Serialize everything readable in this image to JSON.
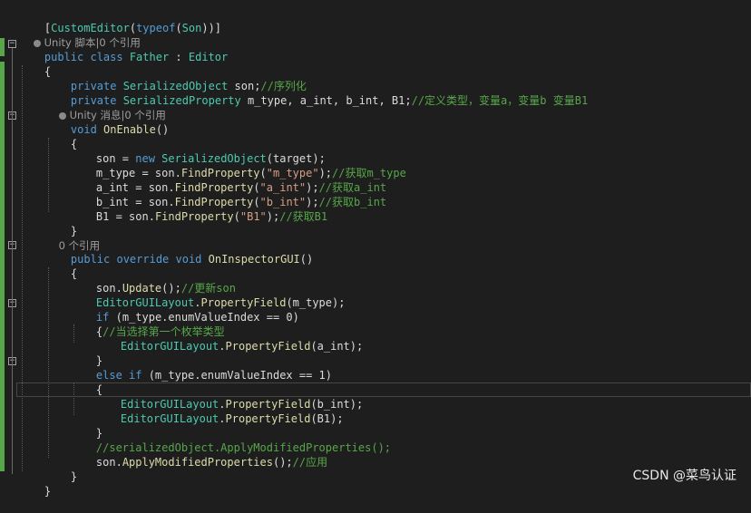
{
  "lines": {
    "l1": {
      "a": "[",
      "b": "CustomEditor",
      "c": "(",
      "d": "typeof",
      "e": "(",
      "f": "Son",
      "g": "))]"
    },
    "lens1": "Unity 脚本|0 个引用",
    "l3": {
      "a": "public class ",
      "b": "Father",
      "c": " : ",
      "d": "Editor"
    },
    "l4": "{",
    "l5": {
      "a": "private ",
      "b": "SerializedObject",
      "c": " son;",
      "d": "//序列化"
    },
    "l6": {
      "a": "private ",
      "b": "SerializedProperty",
      "c": " m_type, a_int, b_int, B1;",
      "d": "//定义类型，变量a，变量b 变量B1"
    },
    "lens2": "Unity 消息|0 个引用",
    "l8": {
      "a": "void ",
      "b": "OnEnable",
      "c": "()"
    },
    "l9": "{",
    "l10": {
      "a": "son = ",
      "b": "new ",
      "c": "SerializedObject",
      "d": "(target);"
    },
    "l11": {
      "a": "m_type = son.",
      "b": "FindProperty",
      "c": "(",
      "d": "\"m_type\"",
      "e": ");",
      "f": "//获取m_type"
    },
    "l12": {
      "a": "a_int = son.",
      "b": "FindProperty",
      "c": "(",
      "d": "\"a_int\"",
      "e": ");",
      "f": "//获取a_int"
    },
    "l13": {
      "a": "b_int = son.",
      "b": "FindProperty",
      "c": "(",
      "d": "\"b_int\"",
      "e": ");",
      "f": "//获取b_int"
    },
    "l14": {
      "a": "B1 = son.",
      "b": "FindProperty",
      "c": "(",
      "d": "\"B1\"",
      "e": ");",
      "f": "//获取B1"
    },
    "l15": "}",
    "lens3": "0 个引用",
    "l17": {
      "a": "public override void ",
      "b": "OnInspectorGUI",
      "c": "()"
    },
    "l18": "{",
    "l19": {
      "a": "son.",
      "b": "Update",
      "c": "();",
      "d": "//更新son"
    },
    "l20": {
      "a": "EditorGUILayout",
      "b": ".",
      "c": "PropertyField",
      "d": "(m_type);"
    },
    "l21": {
      "a": "if ",
      "b": "(m_type.enumValueIndex == 0)"
    },
    "l22": {
      "a": "{",
      "b": "//当选择第一个枚举类型"
    },
    "l23": {
      "a": "EditorGUILayout",
      "b": ".",
      "c": "PropertyField",
      "d": "(a_int);"
    },
    "l24": "}",
    "l25": {
      "a": "else if ",
      "b": "(m_type.enumValueIndex == 1)"
    },
    "l26": "{",
    "l27": {
      "a": "EditorGUILayout",
      "b": ".",
      "c": "PropertyField",
      "d": "(b_int);"
    },
    "l28": {
      "a": "EditorGUILayout",
      "b": ".",
      "c": "PropertyField",
      "d": "(B1);"
    },
    "l29": "}",
    "l30": "//serializedObject.ApplyModifiedProperties();",
    "l31": {
      "a": "son.",
      "b": "ApplyModifiedProperties",
      "c": "();",
      "d": "//应用"
    },
    "l32": "}",
    "l33": "}"
  },
  "fold_glyph": "−",
  "watermark": "CSDN @菜鸟认证",
  "colors": {
    "background": "#1e1e1e",
    "keyword": "#569cd6",
    "type": "#4ec9b0",
    "comment": "#57a64a",
    "string": "#d69d85",
    "method": "#dcdcaa",
    "changed_bar": "#57a64a"
  }
}
